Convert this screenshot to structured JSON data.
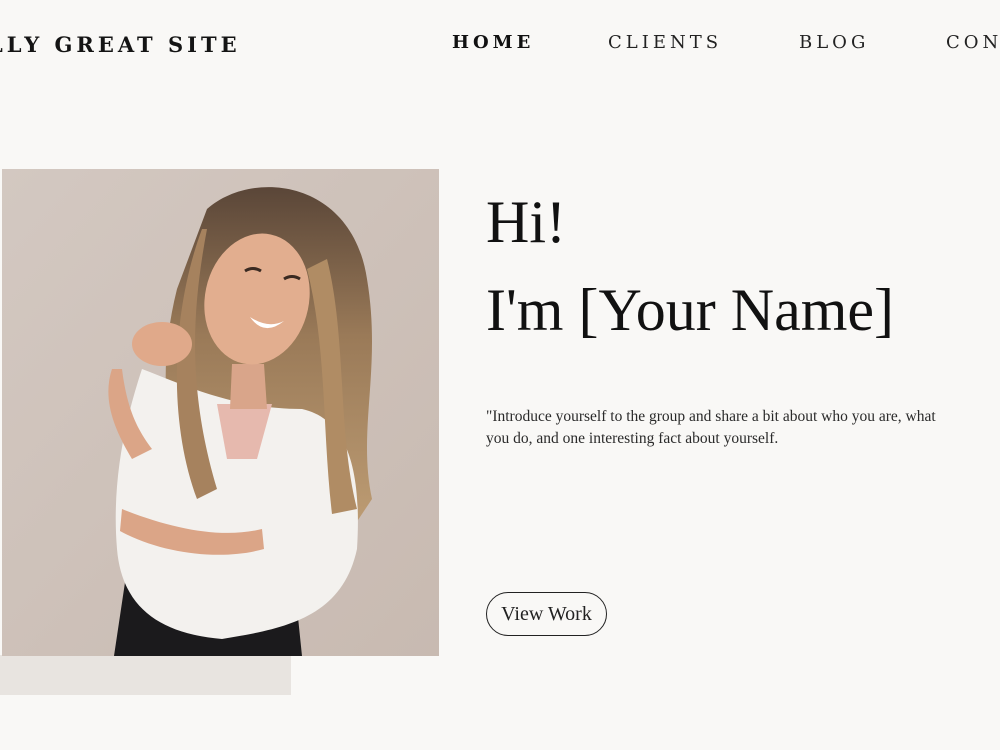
{
  "header": {
    "site_title": "LLY GREAT SITE",
    "nav": [
      {
        "label": "HOME",
        "active": true
      },
      {
        "label": "CLIENTS",
        "active": false
      },
      {
        "label": "BLOG",
        "active": false
      },
      {
        "label": "CONT",
        "active": false
      }
    ]
  },
  "hero": {
    "photo_alt": "Portrait of a smiling woman with long wavy hair wearing a white shirt",
    "headline_line1": "Hi!",
    "headline_line2": "I'm [Your Name]",
    "intro": "\"Introduce yourself to the group and share a bit about who you are, what you do, and one interesting fact about yourself.",
    "cta_label": "View Work"
  },
  "colors": {
    "background": "#f9f8f6",
    "photo_backdrop": "#cec2bb",
    "accent_block": "#e8e4e0",
    "text": "#111111"
  }
}
